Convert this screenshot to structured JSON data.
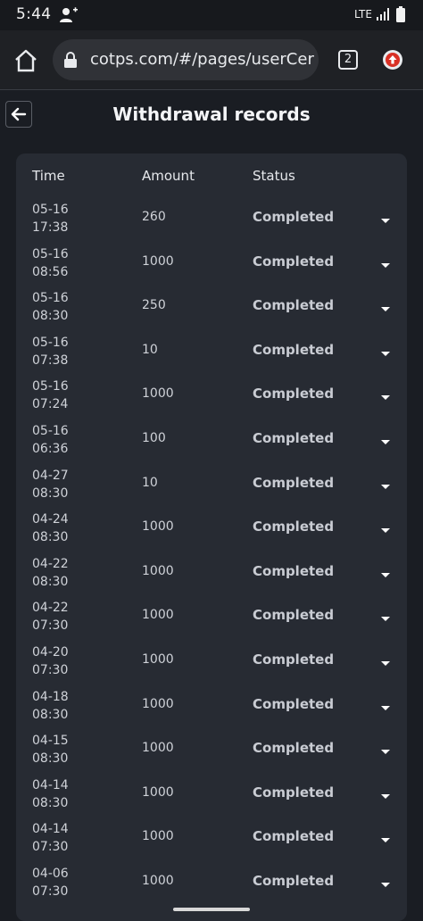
{
  "status_bar": {
    "time": "5:44",
    "network": "LTE"
  },
  "browser": {
    "url": "cotps.com/#/pages/userCer",
    "tab_count": "2"
  },
  "page": {
    "title": "Withdrawal records"
  },
  "table": {
    "headers": {
      "time": "Time",
      "amount": "Amount",
      "status": "Status"
    },
    "rows": [
      {
        "date": "05-16",
        "clock": "17:38",
        "amount": "260",
        "status": "Completed"
      },
      {
        "date": "05-16",
        "clock": "08:56",
        "amount": "1000",
        "status": "Completed"
      },
      {
        "date": "05-16",
        "clock": "08:30",
        "amount": "250",
        "status": "Completed"
      },
      {
        "date": "05-16",
        "clock": "07:38",
        "amount": "10",
        "status": "Completed"
      },
      {
        "date": "05-16",
        "clock": "07:24",
        "amount": "1000",
        "status": "Completed"
      },
      {
        "date": "05-16",
        "clock": "06:36",
        "amount": "100",
        "status": "Completed"
      },
      {
        "date": "04-27",
        "clock": "08:30",
        "amount": "10",
        "status": "Completed"
      },
      {
        "date": "04-24",
        "clock": "08:30",
        "amount": "1000",
        "status": "Completed"
      },
      {
        "date": "04-22",
        "clock": "08:30",
        "amount": "1000",
        "status": "Completed"
      },
      {
        "date": "04-22",
        "clock": "07:30",
        "amount": "1000",
        "status": "Completed"
      },
      {
        "date": "04-20",
        "clock": "07:30",
        "amount": "1000",
        "status": "Completed"
      },
      {
        "date": "04-18",
        "clock": "08:30",
        "amount": "1000",
        "status": "Completed"
      },
      {
        "date": "04-15",
        "clock": "08:30",
        "amount": "1000",
        "status": "Completed"
      },
      {
        "date": "04-14",
        "clock": "08:30",
        "amount": "1000",
        "status": "Completed"
      },
      {
        "date": "04-14",
        "clock": "07:30",
        "amount": "1000",
        "status": "Completed"
      },
      {
        "date": "04-06",
        "clock": "07:30",
        "amount": "1000",
        "status": "Completed"
      }
    ]
  },
  "icons": {
    "user_add": "person-add-icon",
    "signal": "signal-icon",
    "battery": "battery-icon",
    "home": "home-icon",
    "lock": "lock-icon",
    "update": "update-arrow-icon",
    "back": "back-arrow-icon",
    "expand": "chevron-down-icon"
  },
  "colors": {
    "background": "#1a1d23",
    "card": "#272b33",
    "update_accent": "#d93025"
  }
}
